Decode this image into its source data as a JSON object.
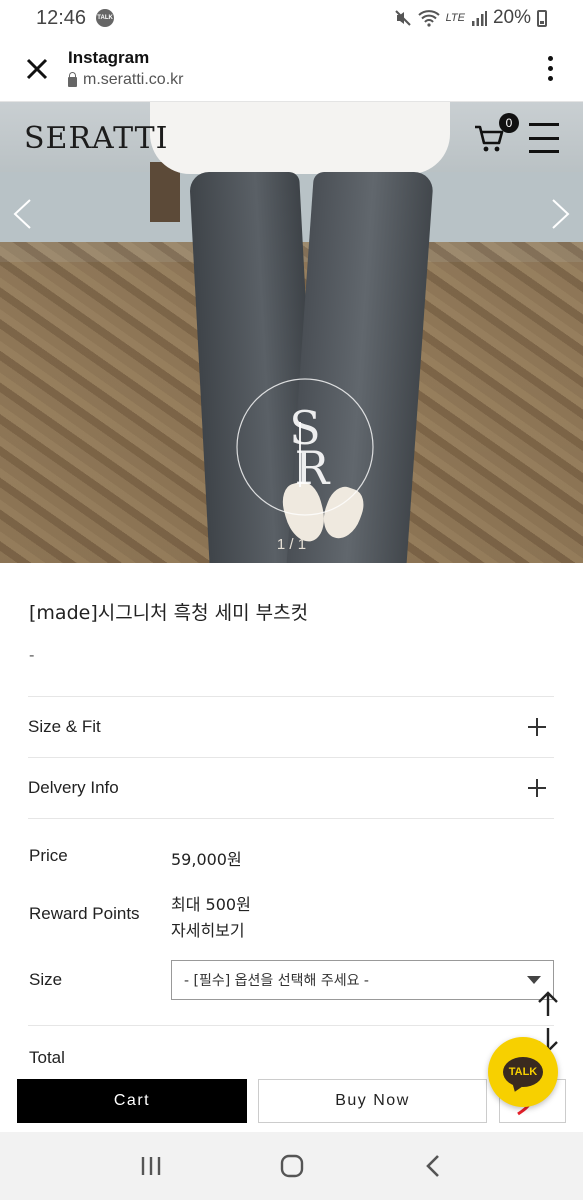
{
  "status_bar": {
    "time": "12:46",
    "battery": "20%",
    "network": "LTE",
    "talk_badge": "TALK"
  },
  "browser": {
    "title": "Instagram",
    "url": "m.seratti.co.kr"
  },
  "site": {
    "logo": "SERATTI",
    "cart_count": "0"
  },
  "carousel": {
    "pager": "1 / 1"
  },
  "product": {
    "title": "[made]시그니처 흑청 세미 부츠컷",
    "subtitle": "-",
    "accordions": [
      "Size & Fit",
      "Delvery Info"
    ],
    "price_label": "Price",
    "price_value": "59,000원",
    "reward_label": "Reward Points",
    "reward_value": "최대 500원",
    "reward_link": "자세히보기",
    "size_label": "Size",
    "size_select": "- [필수] 옵션을 선택해 주세요 -",
    "total_label": "Total"
  },
  "actions": {
    "cart": "Cart",
    "buy_now": "Buy Now",
    "talk": "TALK"
  },
  "colors": {
    "accent": "#000000",
    "talk": "#f7d000",
    "wish": "#e8202a"
  }
}
